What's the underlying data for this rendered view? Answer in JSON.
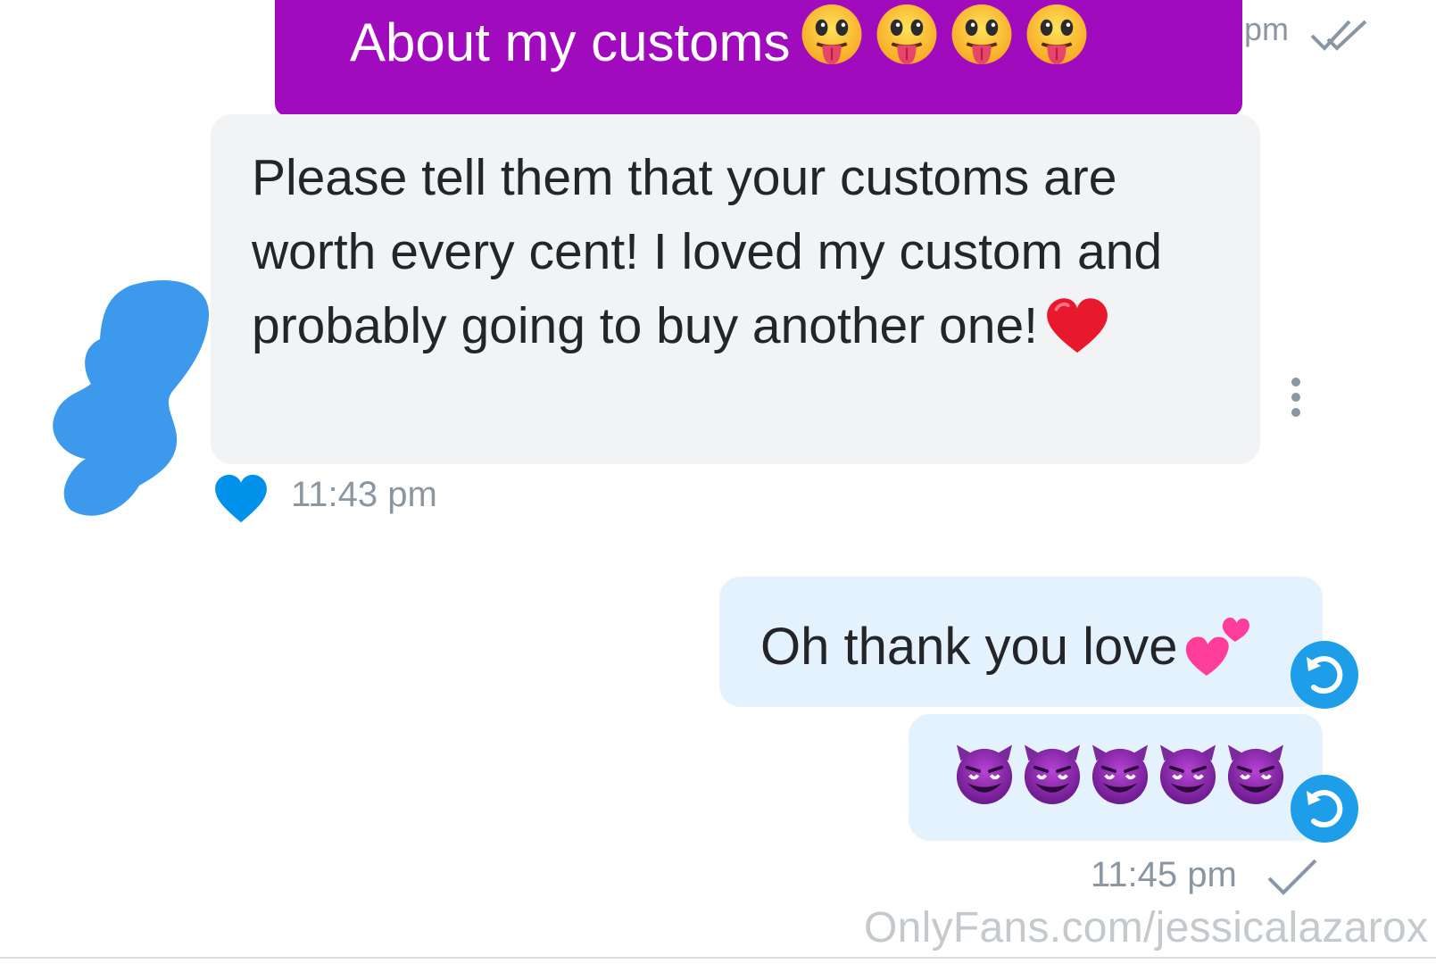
{
  "banner": {
    "text": "About my customs",
    "emoji_icon": "face-with-tongue-icon",
    "emoji_count": 4,
    "color": "#a10bbe"
  },
  "top_status": {
    "time": "pm",
    "icon": "double-check-icon"
  },
  "received_message": {
    "text": "Please tell them that your customs are worth every cent! I loved my custom and probably going to buy another one!",
    "emoji_icon": "red-heart-icon",
    "time": "11:43 pm",
    "like_icon": "blue-heart-icon",
    "like_color": "#0091ea",
    "menu_icon": "more-vertical-icon",
    "bubble_color": "#f2f3f5"
  },
  "sent_messages": [
    {
      "text": "Oh thank you love",
      "emoji_icon": "two-hearts-icon",
      "action_icon": "undo-icon"
    },
    {
      "text": "",
      "emoji_icon": "smiling-devil-icon",
      "emoji_count": 5,
      "action_icon": "undo-icon"
    }
  ],
  "sent_status": {
    "time": "11:45 pm",
    "icon": "single-check-icon"
  },
  "watermark": "OnlyFans.com/jessicalazarox",
  "colors": {
    "accent": "#00aff0",
    "sent_bubble": "#e4f2fd",
    "meta_text": "#8a96a3"
  }
}
